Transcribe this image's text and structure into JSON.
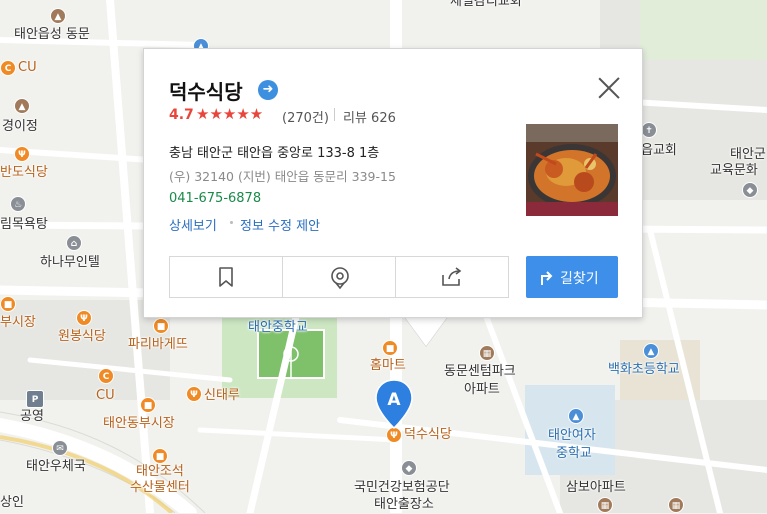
{
  "map": {
    "labels": [
      {
        "id": "church-top",
        "text": "제일감리교회",
        "cls": ""
      },
      {
        "id": "taeaneupseong",
        "text": "태안읍성 동문",
        "cls": ""
      },
      {
        "id": "cu1",
        "text": "CU",
        "cls": "orange"
      },
      {
        "id": "gyeongijeong",
        "text": "경이정",
        "cls": ""
      },
      {
        "id": "bando",
        "text": "반도식당",
        "cls": "orange"
      },
      {
        "id": "rim",
        "text": "림목욕탕",
        "cls": ""
      },
      {
        "id": "hanamu",
        "text": "하나무인텔",
        "cls": ""
      },
      {
        "id": "busijang",
        "text": "부시장",
        "cls": "orange"
      },
      {
        "id": "wonbong",
        "text": "원봉식당",
        "cls": "orange"
      },
      {
        "id": "paris",
        "text": "파리바게뜨",
        "cls": "orange"
      },
      {
        "id": "cu2",
        "text": "CU",
        "cls": "orange"
      },
      {
        "id": "gongyeong",
        "text": "공영",
        "cls": ""
      },
      {
        "id": "dongbu",
        "text": "태안동부시장",
        "cls": "orange"
      },
      {
        "id": "sintaeru",
        "text": "신태루",
        "cls": "orange"
      },
      {
        "id": "post",
        "text": "태안우체국",
        "cls": ""
      },
      {
        "id": "josuk1",
        "text": "태안조석",
        "cls": "orange"
      },
      {
        "id": "josuk2",
        "text": "수산물센터",
        "cls": "orange"
      },
      {
        "id": "ssangin",
        "text": "상인",
        "cls": ""
      },
      {
        "id": "middle",
        "text": "태안중학교",
        "cls": "blue"
      },
      {
        "id": "hommart",
        "text": "홈마트",
        "cls": "orange"
      },
      {
        "id": "dongmun1",
        "text": "동문센텀파크",
        "cls": ""
      },
      {
        "id": "dongmun2",
        "text": "아파트",
        "cls": ""
      },
      {
        "id": "baekhwa",
        "text": "백화초등학교",
        "cls": "blue"
      },
      {
        "id": "deoksu",
        "text": "덕수식당",
        "cls": "orange"
      },
      {
        "id": "girls1",
        "text": "태안여자",
        "cls": "blue"
      },
      {
        "id": "girls2",
        "text": "중학교",
        "cls": "blue"
      },
      {
        "id": "nhis1",
        "text": "국민건강보험공단",
        "cls": ""
      },
      {
        "id": "nhis2",
        "text": "태안출장소",
        "cls": ""
      },
      {
        "id": "sambo",
        "text": "삼보아파트",
        "cls": ""
      },
      {
        "id": "eupchurch",
        "text": "읍교회",
        "cls": ""
      },
      {
        "id": "edu1",
        "text": "태안군",
        "cls": ""
      },
      {
        "id": "edu2",
        "text": "교육문화",
        "cls": ""
      }
    ],
    "marker_letter": "A"
  },
  "card": {
    "name": "덕수식당",
    "verified_icon": "arrow-right-circle-icon",
    "rating": "4.7",
    "stars": "★★★★★",
    "rating_count": "(270건)",
    "review": "리뷰 626",
    "address": "충남 태안군 태안읍 중앙로 133-8 1층",
    "zip_jibun": "(우) 32140   (지번) 태안읍 동문리 339-15",
    "phone": "041-675-6878",
    "detail_link": "상세보기",
    "suggest_link": "정보 수정 제안",
    "route_label": "길찾기",
    "buttons": [
      "bookmark-icon",
      "roadview-icon",
      "share-icon"
    ],
    "accent": "#3d8fe9",
    "rating_color": "#e8463d"
  }
}
